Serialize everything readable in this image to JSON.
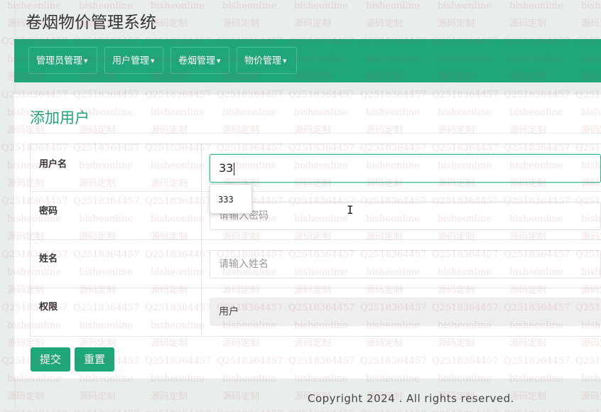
{
  "app": {
    "title": "卷烟物价管理系统"
  },
  "nav": {
    "items": [
      {
        "label": "管理员管理"
      },
      {
        "label": "用户管理"
      },
      {
        "label": "卷烟管理"
      },
      {
        "label": "物价管理"
      }
    ]
  },
  "page": {
    "title": "添加用户"
  },
  "form": {
    "username": {
      "label": "用户名",
      "value": "33"
    },
    "password": {
      "label": "密码",
      "placeholder": "请输入密码"
    },
    "name": {
      "label": "姓名",
      "placeholder": "请输入姓名"
    },
    "role": {
      "label": "权限",
      "value": "用户"
    }
  },
  "autocomplete": {
    "suggestion": "333"
  },
  "buttons": {
    "submit": "提交",
    "reset": "重置"
  },
  "footer": {
    "text": "Copyright 2024 . All rights reserved."
  },
  "watermark": {
    "site": "bisheonline",
    "service": "源码定制",
    "qq": "Q2518364457"
  },
  "colors": {
    "primary": "#1fa67a",
    "background": "#e9eeec"
  }
}
